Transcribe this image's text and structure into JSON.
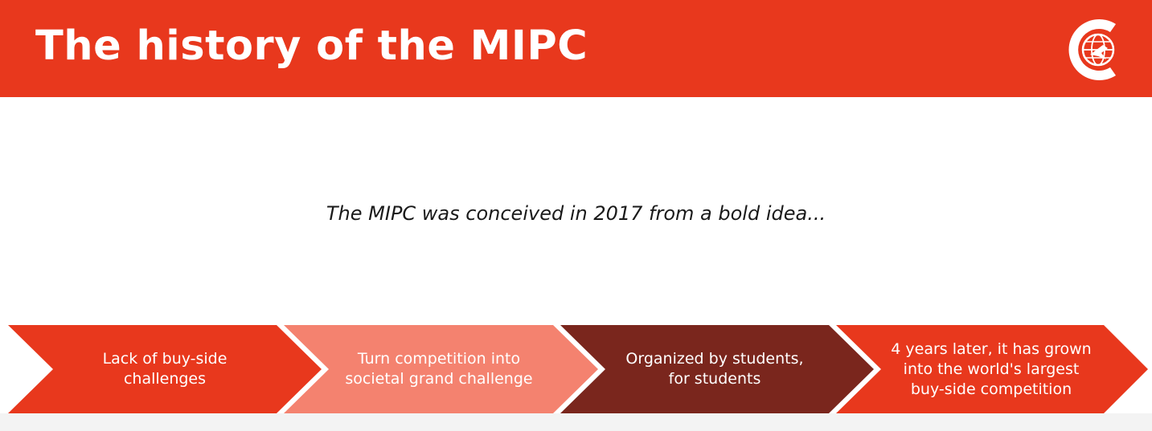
{
  "header": {
    "title": "The history of the MIPC",
    "background_color": "#e8381d",
    "logo_icon": "mipc-globe-logo-icon"
  },
  "subtitle": "The MIPC was conceived in 2017 from a bold idea...",
  "process": {
    "steps": [
      {
        "label": "Lack of buy-side\nchallenges",
        "color": "#e8381d"
      },
      {
        "label": "Turn competition into\nsocietal grand challenge",
        "color": "#f4826f"
      },
      {
        "label": "Organized by students,\nfor students",
        "color": "#7a261d"
      },
      {
        "label": "4 years later, it has grown\ninto the world's largest\nbuy-side competition",
        "color": "#e8381d"
      }
    ]
  }
}
